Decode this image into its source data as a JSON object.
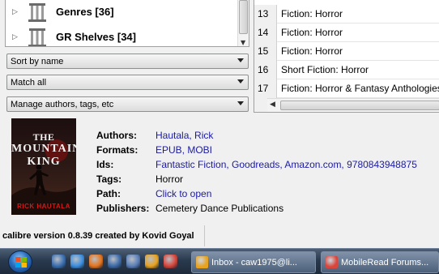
{
  "tag_browser": {
    "items": [
      {
        "label": "Genres [36]",
        "icon": "column-icon"
      },
      {
        "label": "GR Shelves [34]",
        "icon": "column-icon"
      }
    ]
  },
  "controls": {
    "sort": "Sort by name",
    "match": "Match all",
    "manage": "Manage authors, tags, etc"
  },
  "book_list": {
    "rows": [
      {
        "num": "13",
        "title": "Fiction: Horror"
      },
      {
        "num": "14",
        "title": "Fiction: Horror"
      },
      {
        "num": "15",
        "title": "Fiction: Horror"
      },
      {
        "num": "16",
        "title": "Short Fiction: Horror"
      },
      {
        "num": "17",
        "title": "Fiction: Horror & Fantasy Anthologies"
      }
    ]
  },
  "cover": {
    "title_line1": "THE",
    "title_line2": "MOUNTAIN KING",
    "author": "RICK HAUTALA",
    "colors": {
      "title": "#f2f2f2",
      "author": "#d11a1a"
    }
  },
  "details": {
    "authors_label": "Authors:",
    "authors_value": "Hautala, Rick",
    "formats_label": "Formats:",
    "formats_value": "EPUB, MOBI",
    "ids_label": "Ids:",
    "ids_value": "Fantastic Fiction, Goodreads, Amazon.com, 9780843948875",
    "tags_label": "Tags:",
    "tags_value": "Horror",
    "path_label": "Path:",
    "path_value": "Click to open",
    "publishers_label": "Publishers:",
    "publishers_value": "Cemetery Dance Publications",
    "link_color": "#1a1aa6"
  },
  "status_text": "calibre version 0.8.39 created by Kovid Goyal",
  "taskbar": {
    "quick_launch": [
      {
        "icon": "show-desktop-icon",
        "color": "#3a6fb0"
      },
      {
        "icon": "internet-explorer-icon",
        "color": "#3b8ee0"
      },
      {
        "icon": "firefox-icon",
        "color": "#e8741c"
      },
      {
        "icon": "media-icon",
        "color": "#3d6aa8"
      },
      {
        "icon": "calibre-icon",
        "color": "#5a7fb8"
      },
      {
        "icon": "outlook-icon",
        "color": "#e9a21c"
      },
      {
        "icon": "chrome-icon",
        "color": "#d9453a"
      }
    ],
    "tasks": [
      {
        "label": "Inbox - caw1975@li...",
        "icon": "outlook-icon",
        "color": "#e9a21c"
      },
      {
        "label": "MobileRead Forums...",
        "icon": "chrome-icon",
        "color": "#d9453a"
      }
    ]
  }
}
